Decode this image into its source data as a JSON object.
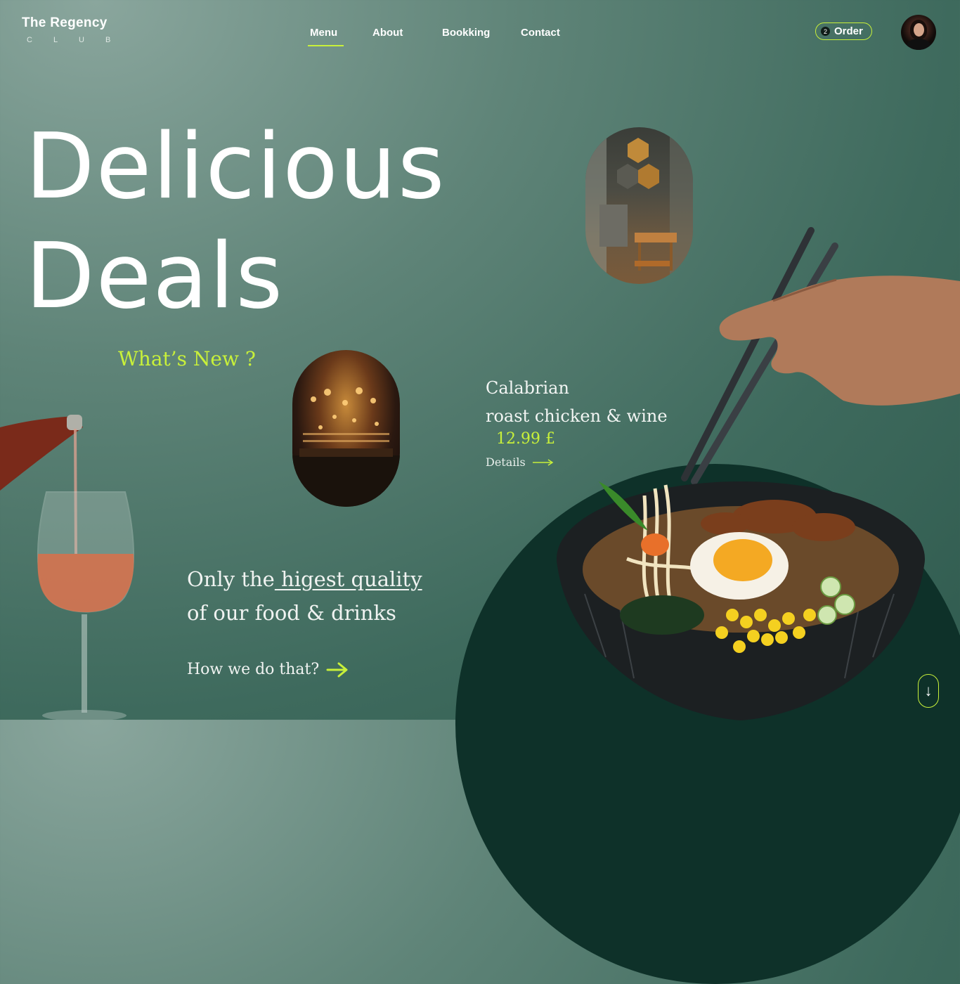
{
  "brand": {
    "name": "The Regency",
    "sub": "CLUB"
  },
  "nav": {
    "items": [
      "Menu",
      "About",
      "Bookking",
      "Contact"
    ],
    "active": "Menu"
  },
  "order": {
    "count": "2",
    "label": "Order"
  },
  "hero": {
    "line1": "Delicious",
    "line2": "Deals"
  },
  "whats_new": "What’s New ?",
  "dish": {
    "line1": "Calabrian",
    "line2": "roast chicken & wine",
    "price": "12.99 £",
    "details": "Details"
  },
  "quality": {
    "prefix": "Only the",
    "highlight": " higest quality",
    "line2": "of our food & drinks"
  },
  "how": "How we do that?",
  "scroll_icon": "↓",
  "colors": {
    "accent": "#c8f03a",
    "dark": "#0e3129"
  }
}
